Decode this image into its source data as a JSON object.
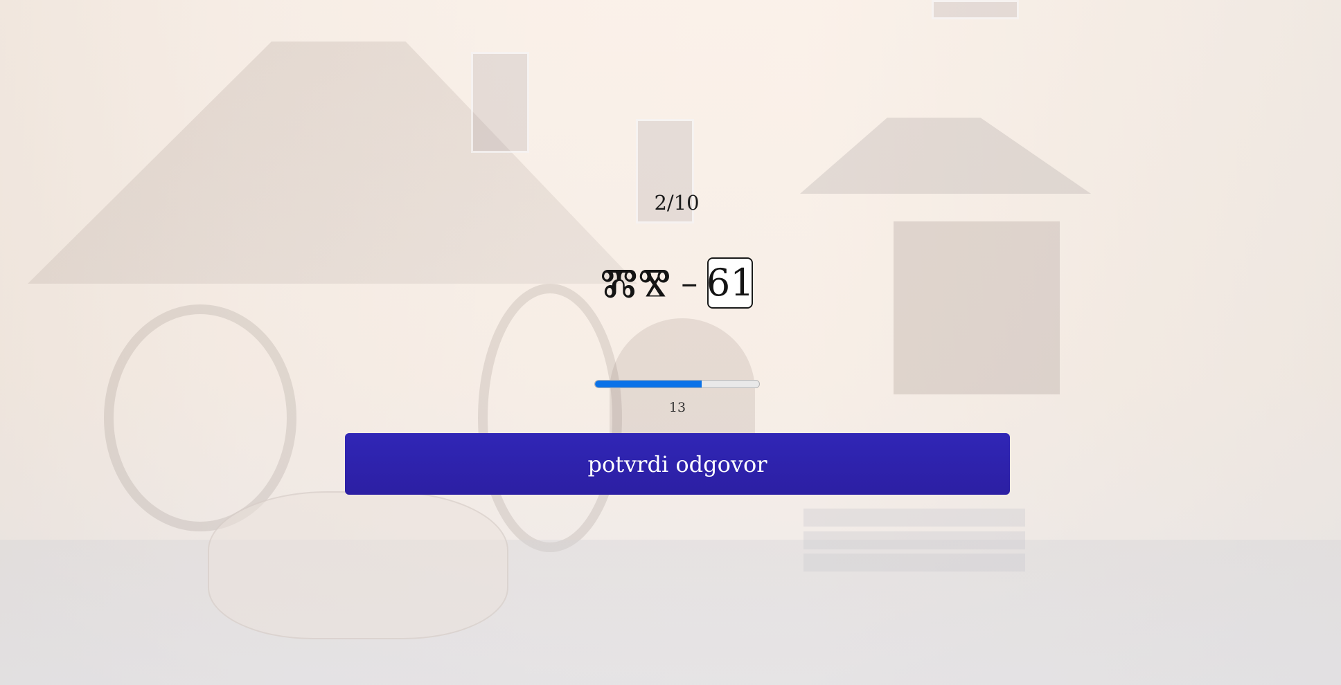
{
  "quiz": {
    "progress_text": "2/10",
    "glyph": "ⰏⰊ",
    "dash": "–",
    "answer_value": "61",
    "timer": {
      "value_text": "13",
      "fill_fraction": 0.65,
      "fill_color": "#0a72e8"
    },
    "confirm_label": "potvrdi odgovor"
  },
  "colors": {
    "button_bg": "#2c20a8",
    "text": "#141414"
  }
}
